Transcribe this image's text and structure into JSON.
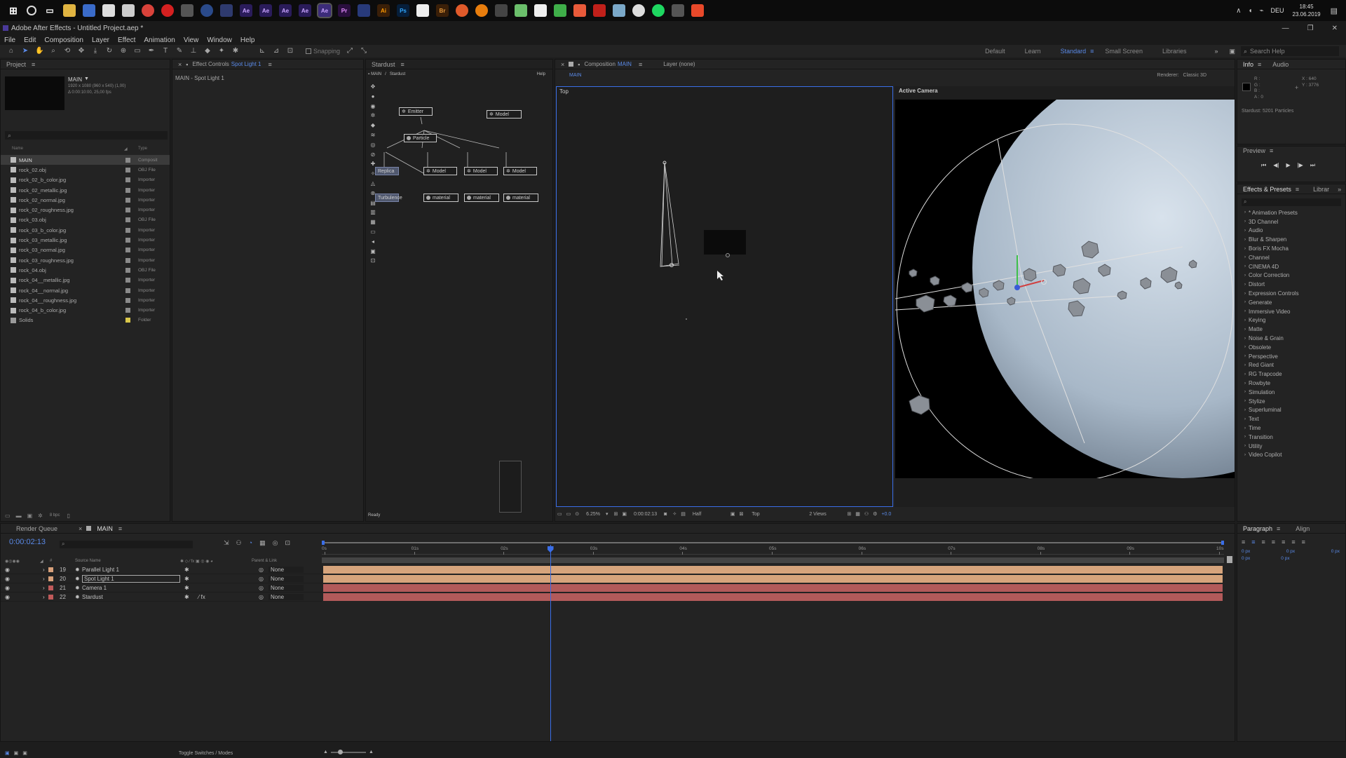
{
  "taskbar": {
    "clock_time": "18:45",
    "clock_date": "23.06.2019",
    "lang": "DEU",
    "apps": [
      "Ae",
      "Ae",
      "Ae",
      "Ae",
      "Ae",
      "Pr",
      "Ai",
      "Ps",
      "Br"
    ]
  },
  "window": {
    "title": "Adobe After Effects - Untitled Project.aep *"
  },
  "menu": [
    "File",
    "Edit",
    "Composition",
    "Layer",
    "Effect",
    "Animation",
    "View",
    "Window",
    "Help"
  ],
  "toolbar": {
    "snapping": "Snapping",
    "workspaces": [
      "Default",
      "Learn",
      "Standard",
      "Small Screen",
      "Libraries"
    ],
    "search_placeholder": "Search Help"
  },
  "project": {
    "title": "Project",
    "comp_name": "MAIN",
    "comp_info1": "1920 x 1080 (960 x 540) (1,00)",
    "comp_info2": "Δ 0:00:10:00, 25,00 fps",
    "col_name": "Name",
    "col_type": "Type",
    "bpc": "8 bpc",
    "items": [
      {
        "name": "MAIN",
        "type": "Composit",
        "color": "#8a8a8a"
      },
      {
        "name": "rock_02.obj",
        "type": "OBJ File",
        "color": "#8a8a8a"
      },
      {
        "name": "rock_02_b_color.jpg",
        "type": "Importer",
        "color": "#8a8a8a"
      },
      {
        "name": "rock_02_metallic.jpg",
        "type": "Importer",
        "color": "#8a8a8a"
      },
      {
        "name": "rock_02_normal.jpg",
        "type": "Importer",
        "color": "#8a8a8a"
      },
      {
        "name": "rock_02_roughness.jpg",
        "type": "Importer",
        "color": "#8a8a8a"
      },
      {
        "name": "rock_03.obj",
        "type": "OBJ File",
        "color": "#8a8a8a"
      },
      {
        "name": "rock_03_b_color.jpg",
        "type": "Importer",
        "color": "#8a8a8a"
      },
      {
        "name": "rock_03_metallic.jpg",
        "type": "Importer",
        "color": "#8a8a8a"
      },
      {
        "name": "rock_03_normal.jpg",
        "type": "Importer",
        "color": "#8a8a8a"
      },
      {
        "name": "rock_03_roughness.jpg",
        "type": "Importer",
        "color": "#8a8a8a"
      },
      {
        "name": "rock_04.obj",
        "type": "OBJ File",
        "color": "#8a8a8a"
      },
      {
        "name": "rock_04__metallic.jpg",
        "type": "Importer",
        "color": "#8a8a8a"
      },
      {
        "name": "rock_04__normal.jpg",
        "type": "Importer",
        "color": "#8a8a8a"
      },
      {
        "name": "rock_04__roughness.jpg",
        "type": "Importer",
        "color": "#8a8a8a"
      },
      {
        "name": "rock_04_b_color.jpg",
        "type": "Importer",
        "color": "#8a8a8a"
      },
      {
        "name": "Solids",
        "type": "Folder",
        "color": "#d9c74a"
      }
    ]
  },
  "effect_controls": {
    "tab": "Effect Controls",
    "layer": "Spot Light 1",
    "breadcrumb": "MAIN - Spot Light 1"
  },
  "stardust": {
    "tab": "Stardust",
    "crumb1": "MAIN",
    "crumb2": "Stardust",
    "help": "Help",
    "status": "Ready",
    "nodes": {
      "emitter": "Emitter",
      "model_top": "Model",
      "particle": "Particle",
      "replica": "Replica",
      "turbulence": "Turbulence",
      "model1": "Model",
      "model2": "Model",
      "model3": "Model",
      "mat1": "material",
      "mat2": "material",
      "mat3": "material"
    }
  },
  "composition": {
    "tab": "Composition",
    "comp": "MAIN",
    "layer_tab": "Layer (none)",
    "comp_crumb": "MAIN",
    "renderer_label": "Renderer:",
    "renderer": "Classic 3D",
    "view_left": "Top",
    "view_right": "Active Camera",
    "zoom": "6.25%",
    "timecode": "0:00:02:13",
    "resolution": "Half",
    "view_select": "Top",
    "views": "2 Views",
    "exposure": "+0.0"
  },
  "info": {
    "tab": "Info",
    "tab2": "Audio",
    "r": "R :",
    "g": "G :",
    "b": "B :",
    "a": "A : 0",
    "x": "X : 640",
    "y": "Y : 3776",
    "stardust_info": "Stardust: 5201 Particles"
  },
  "preview": {
    "title": "Preview"
  },
  "effects": {
    "title": "Effects & Presets",
    "tab2": "Librar",
    "items": [
      "* Animation Presets",
      "3D Channel",
      "Audio",
      "Blur & Sharpen",
      "Boris FX Mocha",
      "Channel",
      "CINEMA 4D",
      "Color Correction",
      "Distort",
      "Expression Controls",
      "Generate",
      "Immersive Video",
      "Keying",
      "Matte",
      "Noise & Grain",
      "Obsolete",
      "Perspective",
      "Red Giant",
      "RG Trapcode",
      "Rowbyte",
      "Simulation",
      "Stylize",
      "Superluminal",
      "Text",
      "Time",
      "Transition",
      "Utility",
      "Video Copilot"
    ]
  },
  "paragraph": {
    "tab": "Paragraph",
    "tab2": "Align",
    "vals": [
      "0 px",
      "0 px",
      "0 px",
      "0 px",
      "0 px"
    ]
  },
  "timeline": {
    "render_queue": "Render Queue",
    "comp_tab": "MAIN",
    "timecode": "0:00:02:13",
    "col_source": "Source Name",
    "col_parent": "Parent & Link",
    "toggle": "Toggle Switches / Modes",
    "ticks": [
      "0s",
      "01s",
      "02s",
      "03s",
      "04s",
      "05s",
      "06s",
      "07s",
      "08s",
      "09s",
      "10s"
    ],
    "playhead": 0.252,
    "layers": [
      {
        "num": "19",
        "name": "Parallel Light 1",
        "parent": "None",
        "color": "#d8a07a",
        "bar": "#d6a47c"
      },
      {
        "num": "20",
        "name": "Spot Light 1",
        "parent": "None",
        "color": "#d8a07a",
        "bar": "#d6a47c"
      },
      {
        "num": "21",
        "name": "Camera 1",
        "parent": "None",
        "color": "#c05a5a",
        "bar": "#b25a5a"
      },
      {
        "num": "22",
        "name": "Stardust",
        "parent": "None",
        "color": "#c05a5a",
        "bar": "#b25a5a"
      }
    ]
  }
}
